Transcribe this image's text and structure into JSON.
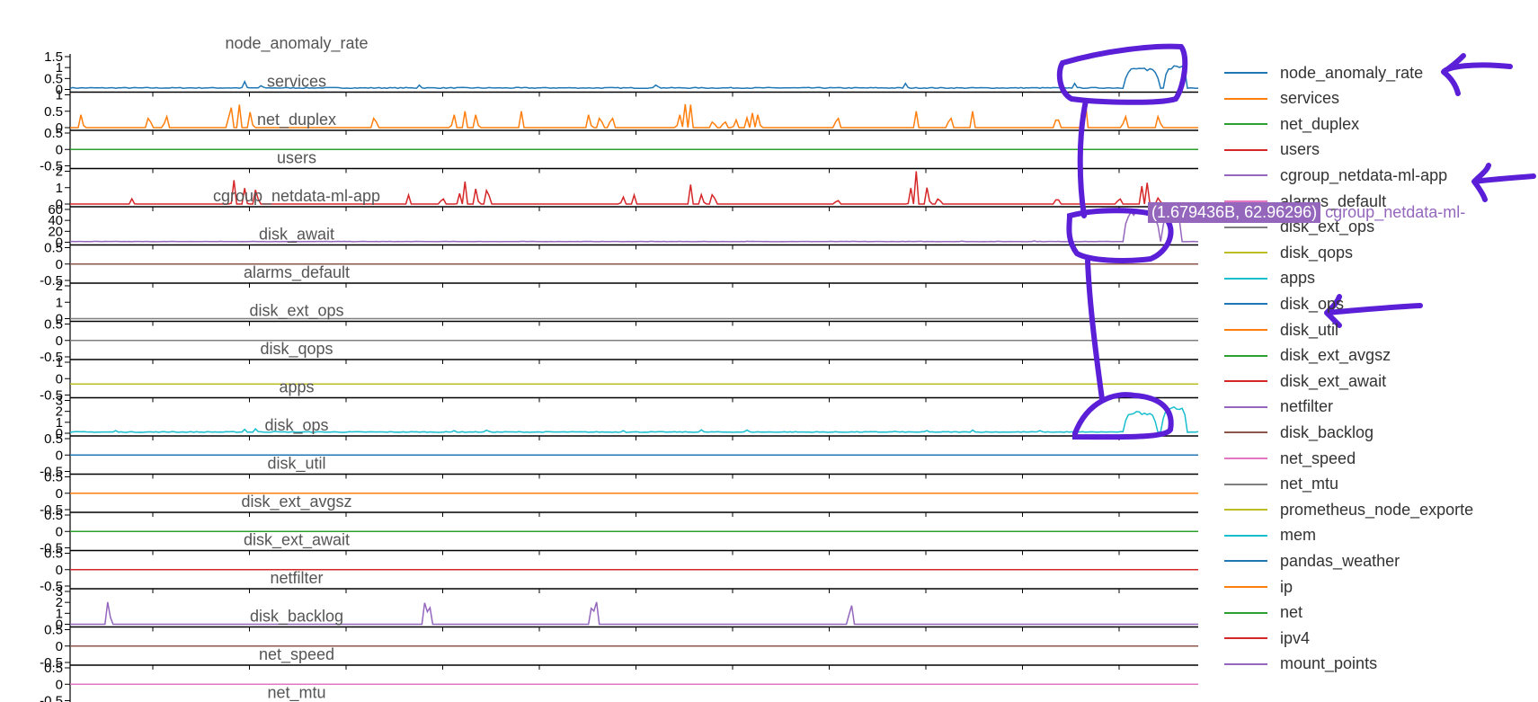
{
  "chart_data": {
    "type": "line",
    "layout_kind": "stacked-subplots",
    "x_axis": {
      "shared": true,
      "tick_labels_visible": false,
      "range": [
        0,
        1
      ]
    },
    "subplots": [
      {
        "name": "node_anomaly_rate",
        "color": "#1f77b4",
        "ticks": [
          "1.5",
          "1",
          "0.5",
          "0"
        ],
        "ylim": [
          0,
          1.5
        ],
        "series": "node_anomaly_rate"
      },
      {
        "name": "services",
        "color": "#ff7f0e",
        "ticks": [
          "1",
          "0.5",
          "0"
        ],
        "ylim": [
          0,
          1
        ],
        "series": "services"
      },
      {
        "name": "net_duplex",
        "color": "#2ca02c",
        "ticks": [
          "0.5",
          "0",
          "-0.5"
        ],
        "ylim": [
          -0.5,
          0.5
        ],
        "series": "net_duplex"
      },
      {
        "name": "users",
        "color": "#d62728",
        "ticks": [
          "2",
          "1",
          "0"
        ],
        "ylim": [
          0,
          2.2
        ],
        "series": "users"
      },
      {
        "name": "cgroup_netdata-ml-app",
        "color": "#9467bd",
        "ticks": [
          "60",
          "40",
          "20",
          "0"
        ],
        "ylim": [
          0,
          65
        ],
        "series": "cgroup_netdata-ml-app"
      },
      {
        "name": "disk_await",
        "color": "#8c564b",
        "ticks": [
          "0.5",
          "0",
          "-0.5"
        ],
        "ylim": [
          -0.5,
          0.5
        ],
        "series": "disk_await"
      },
      {
        "name": "alarms_default",
        "color": "#7f7f7f",
        "ticks": [
          "2",
          "1",
          "0"
        ],
        "ylim": [
          0,
          2
        ],
        "series": "alarms_default"
      },
      {
        "name": "disk_ext_ops",
        "color": "#7f7f7f",
        "ticks": [
          "0.5",
          "0",
          "-0.5"
        ],
        "ylim": [
          -0.5,
          0.5
        ],
        "series": "disk_ext_ops"
      },
      {
        "name": "disk_qops",
        "color": "#bcbd22",
        "ticks": [
          "1",
          "0",
          "-0.5"
        ],
        "ylim": [
          -0.5,
          1
        ],
        "series": "disk_qops"
      },
      {
        "name": "apps",
        "color": "#17becf",
        "ticks": [
          "3",
          "2",
          "1",
          "0"
        ],
        "ylim": [
          0,
          3
        ],
        "series": "apps"
      },
      {
        "name": "disk_ops",
        "color": "#1f77b4",
        "ticks": [
          "0.5",
          "0",
          "-0.5"
        ],
        "ylim": [
          -0.5,
          0.5
        ],
        "series": "disk_ops"
      },
      {
        "name": "disk_util",
        "color": "#ff7f0e",
        "ticks": [
          "0.5",
          "0",
          "-0.5"
        ],
        "ylim": [
          -0.5,
          0.5
        ],
        "series": "disk_util"
      },
      {
        "name": "disk_ext_avgsz",
        "color": "#2ca02c",
        "ticks": [
          "0.5",
          "0",
          "-0.5"
        ],
        "ylim": [
          -0.5,
          0.5
        ],
        "series": "disk_ext_avgsz"
      },
      {
        "name": "disk_ext_await",
        "color": "#d62728",
        "ticks": [
          "0.5",
          "0",
          "-0.5"
        ],
        "ylim": [
          -0.5,
          0.5
        ],
        "series": "disk_ext_await"
      },
      {
        "name": "netfilter",
        "color": "#9467bd",
        "ticks": [
          "3",
          "2",
          "1",
          "0"
        ],
        "ylim": [
          0,
          3
        ],
        "series": "netfilter"
      },
      {
        "name": "disk_backlog",
        "color": "#8c564b",
        "ticks": [
          "0.5",
          "0",
          "-0.5"
        ],
        "ylim": [
          -0.5,
          0.5
        ],
        "series": "disk_backlog"
      },
      {
        "name": "net_speed",
        "color": "#e377c2",
        "ticks": [
          "0.5",
          "0",
          "-0.5"
        ],
        "ylim": [
          -0.5,
          0.5
        ],
        "series": "net_speed"
      }
    ],
    "subplot_titles": [
      "node_anomaly_rate",
      "services",
      "net_duplex",
      "users",
      "cgroup_netdata-ml-app",
      "disk_await",
      "alarms_default",
      "disk_ext_ops",
      "disk_qops",
      "apps",
      "disk_ops",
      "disk_util",
      "disk_ext_avgsz",
      "disk_ext_await",
      "netfilter",
      "disk_backlog",
      "net_speed",
      "net_mtu"
    ],
    "series_shapes": {
      "node_anomaly_rate": {
        "kind": "noise",
        "base": 0.05,
        "spikes": [
          [
            0.155,
            0.4
          ],
          [
            0.17,
            0.3
          ],
          [
            0.31,
            0.25
          ],
          [
            0.52,
            0.35
          ],
          [
            0.74,
            0.35
          ],
          [
            0.89,
            0.35
          ]
        ],
        "bursts": [
          [
            0.935,
            0.965,
            1.0
          ],
          [
            0.97,
            0.99,
            1.1
          ]
        ]
      },
      "services": {
        "kind": "spikes",
        "base": 0,
        "spikes": [
          [
            0.01,
            0.5
          ],
          [
            0.07,
            0.5
          ],
          [
            0.085,
            0.5
          ],
          [
            0.142,
            1.0
          ],
          [
            0.15,
            0.7
          ],
          [
            0.16,
            0.6
          ],
          [
            0.27,
            0.5
          ],
          [
            0.34,
            0.5
          ],
          [
            0.35,
            0.5
          ],
          [
            0.36,
            0.5
          ],
          [
            0.4,
            0.5
          ],
          [
            0.46,
            0.5
          ],
          [
            0.47,
            0.5
          ],
          [
            0.48,
            0.5
          ],
          [
            0.54,
            0.5
          ],
          [
            0.545,
            0.8
          ],
          [
            0.55,
            0.7
          ],
          [
            0.57,
            0.3
          ],
          [
            0.58,
            0.3
          ],
          [
            0.59,
            0.3
          ],
          [
            0.6,
            0.3
          ],
          [
            0.605,
            0.5
          ],
          [
            0.61,
            0.5
          ],
          [
            0.68,
            0.5
          ],
          [
            0.75,
            0.5
          ],
          [
            0.78,
            0.5
          ],
          [
            0.8,
            0.5
          ],
          [
            0.875,
            0.5
          ],
          [
            0.9,
            0.8
          ],
          [
            0.935,
            0.5
          ],
          [
            0.965,
            0.5
          ]
        ],
        "bursts": []
      },
      "net_duplex": {
        "kind": "flat",
        "value": 0
      },
      "users": {
        "kind": "spikes",
        "base": 0,
        "spikes": [
          [
            0.055,
            0.4
          ],
          [
            0.145,
            1.8
          ],
          [
            0.155,
            1.2
          ],
          [
            0.165,
            1.4
          ],
          [
            0.3,
            0.6
          ],
          [
            0.33,
            0.6
          ],
          [
            0.345,
            0.8
          ],
          [
            0.35,
            1.5
          ],
          [
            0.36,
            1.3
          ],
          [
            0.37,
            1.6
          ],
          [
            0.49,
            0.6
          ],
          [
            0.5,
            0.6
          ],
          [
            0.55,
            1.3
          ],
          [
            0.56,
            0.8
          ],
          [
            0.57,
            1.1
          ],
          [
            0.68,
            0.4
          ],
          [
            0.745,
            1.2
          ],
          [
            0.75,
            2.2
          ],
          [
            0.76,
            1.4
          ],
          [
            0.77,
            0.6
          ],
          [
            0.875,
            0.6
          ],
          [
            0.93,
            0.6
          ],
          [
            0.95,
            1.2
          ],
          [
            0.955,
            1.6
          ],
          [
            0.965,
            0.6
          ]
        ],
        "bursts": []
      },
      "cgroup_netdata-ml-app": {
        "kind": "noise",
        "base": 1,
        "spikes": [
          [
            0.08,
            2
          ],
          [
            0.6,
            2
          ],
          [
            0.79,
            3
          ],
          [
            0.82,
            2
          ],
          [
            0.855,
            3
          ]
        ],
        "bursts": [
          [
            0.935,
            0.965,
            62.96
          ],
          [
            0.968,
            0.985,
            62
          ]
        ]
      },
      "disk_await": {
        "kind": "flat",
        "value": 0
      },
      "alarms_default": {
        "kind": "flat",
        "value": 0
      },
      "disk_ext_ops": {
        "kind": "flat",
        "value": 0
      },
      "disk_qops": {
        "kind": "flat",
        "value": 0
      },
      "apps": {
        "kind": "noise",
        "base": 0.08,
        "spikes": [
          [
            0.04,
            0.3
          ],
          [
            0.09,
            0.2
          ],
          [
            0.155,
            0.4
          ],
          [
            0.165,
            0.6
          ],
          [
            0.18,
            0.3
          ],
          [
            0.34,
            0.3
          ],
          [
            0.37,
            0.5
          ],
          [
            0.49,
            0.3
          ],
          [
            0.56,
            0.4
          ],
          [
            0.6,
            0.3
          ],
          [
            0.73,
            0.3
          ],
          [
            0.76,
            0.3
          ],
          [
            0.8,
            0.3
          ],
          [
            0.86,
            0.3
          ]
        ],
        "bursts": [
          [
            0.935,
            0.963,
            2.0
          ],
          [
            0.968,
            0.99,
            2.4
          ]
        ]
      },
      "disk_ops": {
        "kind": "flat",
        "value": 0
      },
      "disk_util": {
        "kind": "flat",
        "value": 0
      },
      "disk_ext_avgsz": {
        "kind": "flat",
        "value": 0
      },
      "disk_ext_await": {
        "kind": "flat",
        "value": 0
      },
      "netfilter": {
        "kind": "spikes",
        "base": 0,
        "spikes": [
          [
            0.034,
            2.9
          ],
          [
            0.315,
            2.9
          ],
          [
            0.318,
            2.9
          ],
          [
            0.463,
            2.9
          ],
          [
            0.466,
            2.9
          ],
          [
            0.692,
            2.8
          ]
        ],
        "bursts": []
      },
      "disk_backlog": {
        "kind": "flat",
        "value": 0
      },
      "net_speed": {
        "kind": "flat",
        "value": 0
      }
    },
    "hover": {
      "series": "cgroup_netdata-ml-app",
      "value": "(1.679436B, 62.96296)",
      "label": "cgroup_netdata-ml-",
      "color": "#9467bd"
    },
    "legend": {
      "placement": "right",
      "items": [
        {
          "name": "node_anomaly_rate",
          "color": "#1f77b4"
        },
        {
          "name": "services",
          "color": "#ff7f0e"
        },
        {
          "name": "net_duplex",
          "color": "#2ca02c"
        },
        {
          "name": "users",
          "color": "#d62728"
        },
        {
          "name": "cgroup_netdata-ml-app",
          "color": "#9467bd"
        },
        {
          "name": "alarms_default",
          "color": "#e377c2"
        },
        {
          "name": "disk_ext_ops",
          "color": "#7f7f7f"
        },
        {
          "name": "disk_qops",
          "color": "#bcbd22"
        },
        {
          "name": "apps",
          "color": "#17becf"
        },
        {
          "name": "disk_ops",
          "color": "#1f77b4"
        },
        {
          "name": "disk_util",
          "color": "#ff7f0e"
        },
        {
          "name": "disk_ext_avgsz",
          "color": "#2ca02c"
        },
        {
          "name": "disk_ext_await",
          "color": "#d62728"
        },
        {
          "name": "netfilter",
          "color": "#9467bd"
        },
        {
          "name": "disk_backlog",
          "color": "#8c564b"
        },
        {
          "name": "net_speed",
          "color": "#e377c2"
        },
        {
          "name": "net_mtu",
          "color": "#7f7f7f"
        },
        {
          "name": "prometheus_node_exporte",
          "color": "#bcbd22"
        },
        {
          "name": "mem",
          "color": "#17becf"
        },
        {
          "name": "pandas_weather",
          "color": "#1f77b4"
        },
        {
          "name": "ip",
          "color": "#ff7f0e"
        },
        {
          "name": "net",
          "color": "#2ca02c"
        },
        {
          "name": "ipv4",
          "color": "#d62728"
        },
        {
          "name": "mount_points",
          "color": "#9467bd"
        }
      ]
    },
    "annotation_color": "#5a1fd6"
  }
}
